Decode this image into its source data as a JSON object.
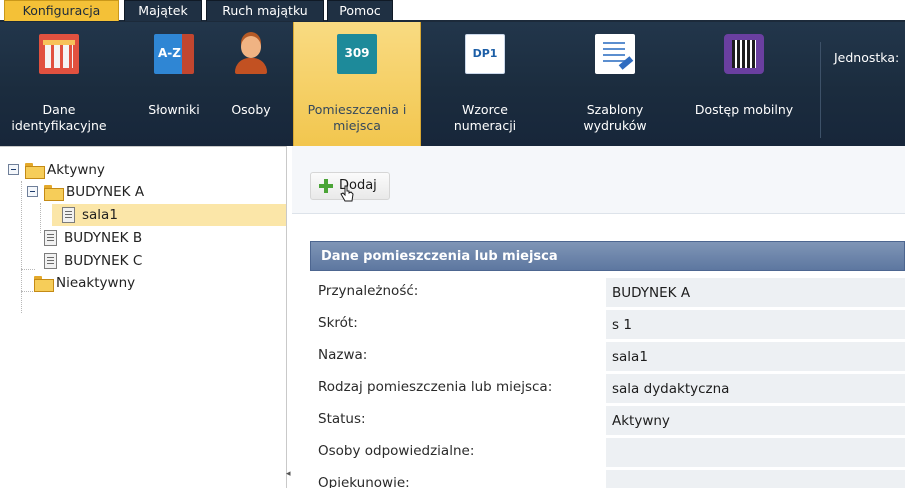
{
  "menu": {
    "tabs": [
      {
        "label": "Konfiguracja",
        "active": true
      },
      {
        "label": "Majątek",
        "active": false
      },
      {
        "label": "Ruch majątku",
        "active": false
      },
      {
        "label": "Pomoc",
        "active": false
      }
    ]
  },
  "ribbon": {
    "buttons": [
      {
        "label": "Dane identyfikacyjne",
        "icon": "building-icon",
        "active": false
      },
      {
        "label": "Słowniki",
        "icon": "dictionary-icon",
        "icon_text": "A-Z",
        "active": false
      },
      {
        "label": "Osoby",
        "icon": "person-icon",
        "active": false
      },
      {
        "label": "Pomieszczenia i miejsca",
        "icon": "room-icon",
        "icon_text": "309",
        "active": true
      },
      {
        "label": "Wzorce numeracji",
        "icon": "numbering-icon",
        "icon_text": "DP1",
        "active": false
      },
      {
        "label": "Szablony wydruków",
        "icon": "print-template-icon",
        "active": false
      },
      {
        "label": "Dostęp mobilny",
        "icon": "qr-code-icon",
        "active": false
      }
    ],
    "unit_label": "Jednostka:"
  },
  "tree": {
    "nodes": [
      {
        "label": "Aktywny",
        "type": "folder",
        "expanded": true
      },
      {
        "label": "BUDYNEK A",
        "type": "folder",
        "expanded": true
      },
      {
        "label": "sala1",
        "type": "document",
        "selected": true
      },
      {
        "label": "BUDYNEK B",
        "type": "document"
      },
      {
        "label": "BUDYNEK C",
        "type": "document"
      },
      {
        "label": "Nieaktywny",
        "type": "folder"
      }
    ]
  },
  "toolbar": {
    "add_label": "Dodaj"
  },
  "form": {
    "title": "Dane pomieszczenia lub miejsca",
    "fields": [
      {
        "label": "Przynależność:",
        "value": "BUDYNEK A"
      },
      {
        "label": "Skrót:",
        "value": "s 1"
      },
      {
        "label": "Nazwa:",
        "value": "sala1"
      },
      {
        "label": "Rodzaj pomieszczenia lub miejsca:",
        "value": "sala dydaktyczna"
      },
      {
        "label": "Status:",
        "value": "Aktywny"
      },
      {
        "label": "Osoby odpowiedzialne:",
        "value": ""
      },
      {
        "label": "Opiekunowie:",
        "value": ""
      }
    ]
  },
  "colors": {
    "ribbon_bg": "#1b2c3e",
    "active_tab": "#f4c137",
    "panel_header": "#6d84aa",
    "tree_selected": "#fbe6a8"
  }
}
